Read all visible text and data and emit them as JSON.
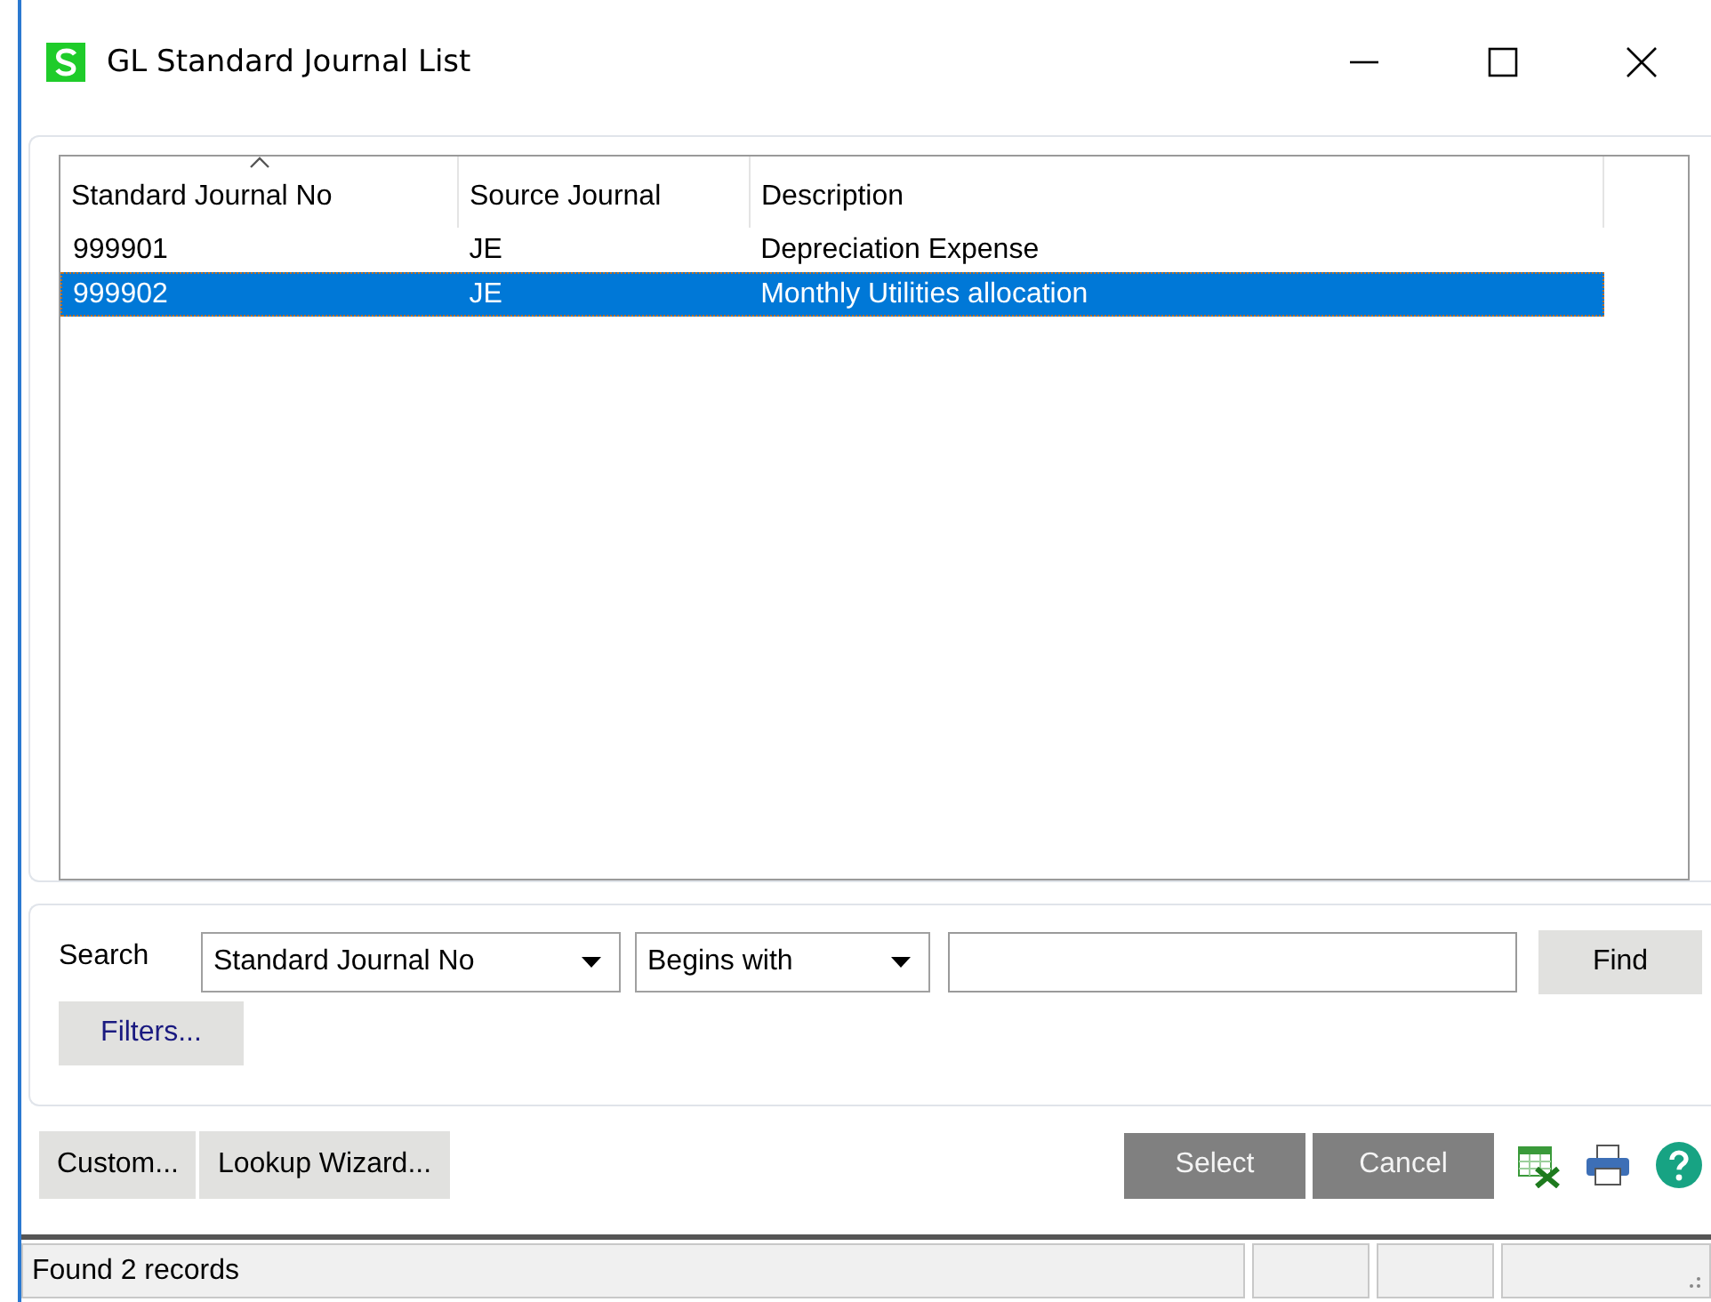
{
  "window": {
    "title": "GL Standard Journal List"
  },
  "table": {
    "columns": [
      {
        "label": "Standard Journal No",
        "sorted": true
      },
      {
        "label": "Source Journal",
        "sorted": false
      },
      {
        "label": "Description",
        "sorted": false
      }
    ],
    "rows": [
      {
        "cells": [
          "999901",
          "JE",
          "Depreciation Expense"
        ],
        "selected": false
      },
      {
        "cells": [
          "999902",
          "JE",
          "Monthly Utilities allocation"
        ],
        "selected": true
      }
    ]
  },
  "search": {
    "label": "Search",
    "field": "Standard Journal No",
    "operator": "Begins with",
    "find_button": "Find",
    "filters_button": "Filters..."
  },
  "buttons_left": [
    "Custom...",
    "Lookup Wizard..."
  ],
  "buttons_right": [
    "Select",
    "Cancel"
  ],
  "status_bar": {
    "text": "Found 2 records"
  }
}
